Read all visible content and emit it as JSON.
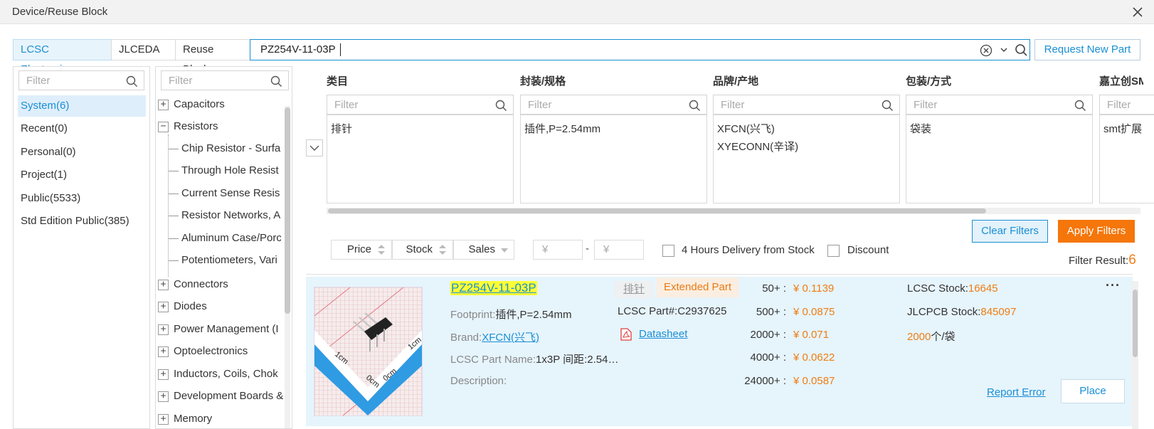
{
  "window": {
    "title": "Device/Reuse Block"
  },
  "tabs": [
    {
      "label": "LCSC Electronics",
      "active": true
    },
    {
      "label": "JLCEDA",
      "active": false
    },
    {
      "label": "Reuse Block",
      "active": false
    }
  ],
  "search": {
    "value": "PZ254V-11-03P"
  },
  "request_new_part": "Request New Part",
  "library": {
    "filter_placeholder": "Filter",
    "items": [
      {
        "label": "System(6)",
        "selected": true
      },
      {
        "label": "Recent(0)"
      },
      {
        "label": "Personal(0)"
      },
      {
        "label": "Project(1)"
      },
      {
        "label": "Public(5533)"
      },
      {
        "label": "Std Edition Public(385)"
      }
    ]
  },
  "categories": {
    "filter_placeholder": "Filter",
    "items": [
      {
        "label": "Capacitors",
        "sign": "+"
      },
      {
        "label": "Resistors",
        "sign": "−",
        "children": [
          "Chip Resistor - Surfa",
          "Through Hole Resist",
          "Current Sense Resis",
          "Resistor Networks, A",
          "Aluminum Case/Porc",
          "Potentiometers, Vari"
        ]
      },
      {
        "label": "Connectors",
        "sign": "+"
      },
      {
        "label": "Diodes",
        "sign": "+"
      },
      {
        "label": "Power Management (I",
        "sign": "+"
      },
      {
        "label": "Optoelectronics",
        "sign": "+"
      },
      {
        "label": "Inductors, Coils, Chok",
        "sign": "+"
      },
      {
        "label": "Development Boards &",
        "sign": "+"
      },
      {
        "label": "Memory",
        "sign": "+"
      }
    ]
  },
  "filter_columns": [
    {
      "title": "类目",
      "placeholder": "Filter",
      "values": [
        "排针"
      ]
    },
    {
      "title": "封装/规格",
      "placeholder": "Filter",
      "values": [
        "插件,P=2.54mm"
      ]
    },
    {
      "title": "品牌/产地",
      "placeholder": "Filter",
      "values": [
        "XFCN(兴飞)",
        "XYECONN(辛译)"
      ]
    },
    {
      "title": "包装/方式",
      "placeholder": "Filter",
      "values": [
        "袋装"
      ]
    },
    {
      "title": "嘉立创SM",
      "placeholder": "Filter",
      "values": [
        "smt扩展"
      ]
    }
  ],
  "buttons": {
    "clear": "Clear Filters",
    "apply": "Apply Filters"
  },
  "sort": {
    "price": "Price",
    "stock": "Stock",
    "sales": "Sales"
  },
  "price_range": {
    "min_placeholder": "¥",
    "max_placeholder": "¥",
    "dash": "-"
  },
  "options": {
    "delivery": "4 Hours Delivery from Stock",
    "discount": "Discount"
  },
  "filter_result": {
    "label": "Filter Result:",
    "count": "6"
  },
  "part": {
    "name": "PZ254V-11-03P",
    "tag_category": "排针",
    "tag_type": "Extended Part",
    "footprint_label": "Footprint:",
    "footprint": "插件,P=2.54mm",
    "brand_label": "Brand:",
    "brand": "XFCN(兴飞)",
    "partname_label": "LCSC Part Name:",
    "partname": "1x3P 间距:2.54…",
    "description_label": "Description:",
    "lcsc_part": "LCSC Part#:C2937625",
    "datasheet": "Datasheet",
    "prices": [
      {
        "qty": "50+ :",
        "price": "¥ 0.1139"
      },
      {
        "qty": "500+ :",
        "price": "¥ 0.0875"
      },
      {
        "qty": "2000+ :",
        "price": "¥ 0.071"
      },
      {
        "qty": "4000+ :",
        "price": "¥ 0.0622"
      },
      {
        "qty": "24000+ :",
        "price": "¥ 0.0587"
      }
    ],
    "lcsc_stock_label": "LCSC Stock:",
    "lcsc_stock": "16645",
    "jlcpcb_stock_label": "JLCPCB Stock:",
    "jlcpcb_stock": "845097",
    "pack_qty": "2000",
    "pack_unit": "个/袋",
    "more": "···",
    "report_error": "Report Error",
    "place": "Place"
  },
  "colors": {
    "accent": "#1a8fd4",
    "orange": "#ef7d12",
    "result_bg": "#e6f4fc"
  }
}
